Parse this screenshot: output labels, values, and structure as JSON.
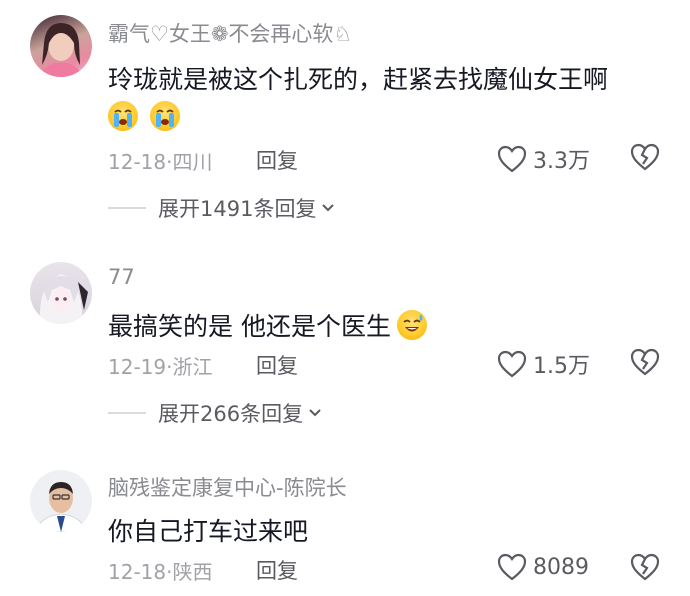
{
  "comments": [
    {
      "username": "霸气♡女王❁不会再心软♘",
      "text": "玲珑就是被这个扎死的，赶紧去找魔仙女王啊",
      "emoji_row": [
        "crying-face-icon",
        "crying-face-icon"
      ],
      "date_location": "12-18·四川",
      "reply_label": "回复",
      "likes": "3.3万",
      "expand_label": "展开1491条回复"
    },
    {
      "username": "77",
      "text": "最搞笑的是 他还是个医生",
      "inline_emoji": "grinning-sweat-face-icon",
      "date_location": "12-19·浙江",
      "reply_label": "回复",
      "likes": "1.5万",
      "expand_label": "展开266条回复"
    },
    {
      "username": "脑残鉴定康复中心-陈院长",
      "text": "你自己打车过来吧",
      "date_location": "12-18·陕西",
      "reply_label": "回复",
      "likes": "8089"
    }
  ],
  "colors": {
    "username": "#8a8b91",
    "text": "#161823",
    "meta": "#a1a2a7",
    "action": "#5a5b61"
  }
}
